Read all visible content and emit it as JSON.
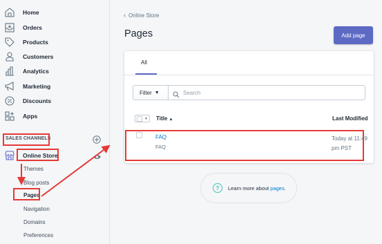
{
  "sidebar": {
    "items": [
      {
        "label": "Home",
        "icon": "home-icon"
      },
      {
        "label": "Orders",
        "icon": "orders-icon"
      },
      {
        "label": "Products",
        "icon": "tag-icon"
      },
      {
        "label": "Customers",
        "icon": "person-icon"
      },
      {
        "label": "Analytics",
        "icon": "bar-chart-icon"
      },
      {
        "label": "Marketing",
        "icon": "megaphone-icon"
      },
      {
        "label": "Discounts",
        "icon": "discount-icon"
      },
      {
        "label": "Apps",
        "icon": "apps-icon"
      }
    ],
    "sales_channels_title": "SALES CHANNELS",
    "online_store_label": "Online Store",
    "sub_items": [
      "Themes",
      "Blog posts",
      "Pages",
      "Navigation",
      "Domains",
      "Preferences"
    ]
  },
  "breadcrumb": "Online Store",
  "page_title": "Pages",
  "add_button": "Add page",
  "tabs": [
    "All"
  ],
  "filter_label": "Filter",
  "search_placeholder": "Search",
  "table": {
    "columns": [
      "Title",
      "Last Modified"
    ],
    "rows": [
      {
        "title": "FAQ",
        "subtitle": "FAQ",
        "modified": "Today at 11:49 pm PST"
      }
    ]
  },
  "learn": {
    "prefix": "Learn more about ",
    "link": "pages",
    "suffix": "."
  },
  "colors": {
    "accent": "#5c6ac4",
    "link": "#007ace",
    "highlight": "#e53935"
  }
}
